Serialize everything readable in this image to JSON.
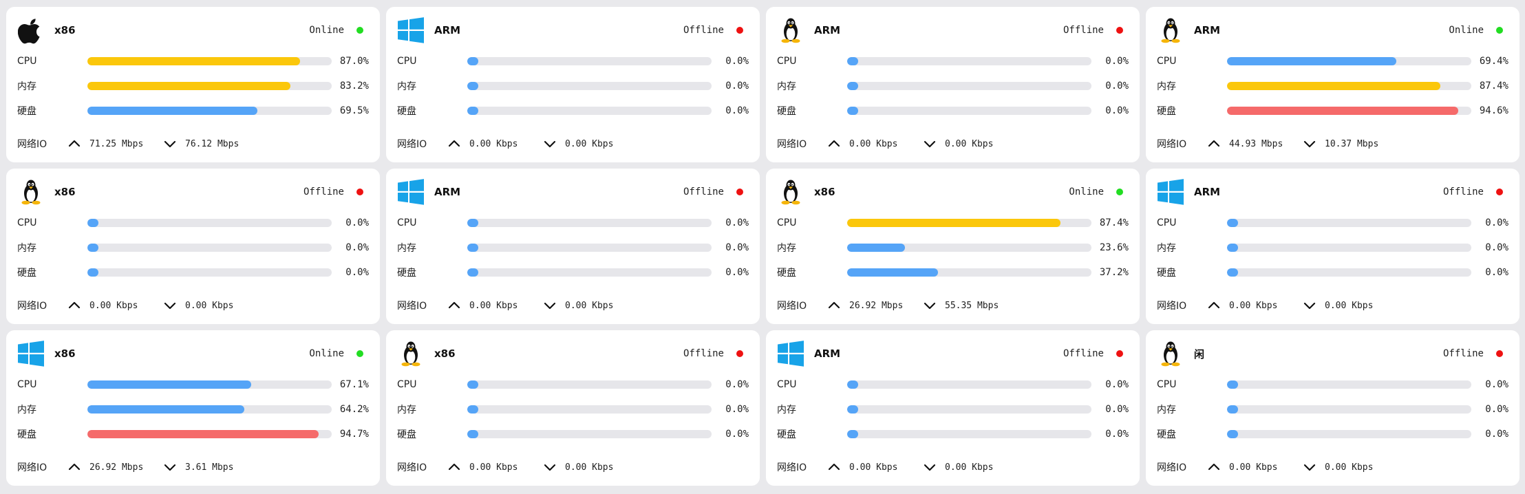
{
  "labels": {
    "cpu": "CPU",
    "mem": "内存",
    "disk": "硬盘",
    "net": "网络IO"
  },
  "colors": {
    "online": "#22dd22",
    "offline": "#ee1111",
    "yellow": "#fbc70b",
    "blue": "#55a4f7",
    "red": "#f56a6a",
    "track": "#e6e6ea",
    "windows": "#18a3e8"
  },
  "cards": [
    {
      "os_icon": "apple-icon",
      "arch": "x86",
      "status": "Online",
      "online": true,
      "cpu": {
        "value": 87.0,
        "text": "87.0%",
        "color": "yellow"
      },
      "mem": {
        "value": 83.2,
        "text": "83.2%",
        "color": "yellow"
      },
      "disk": {
        "value": 69.5,
        "text": "69.5%",
        "color": "blue"
      },
      "net_up": "71.25 Mbps",
      "net_down": "76.12 Mbps"
    },
    {
      "os_icon": "windows-icon",
      "arch": "ARM",
      "status": "Offline",
      "online": false,
      "cpu": {
        "value": 0.0,
        "text": "0.0%",
        "color": "blue"
      },
      "mem": {
        "value": 0.0,
        "text": "0.0%",
        "color": "blue"
      },
      "disk": {
        "value": 0.0,
        "text": "0.0%",
        "color": "blue"
      },
      "net_up": "0.00 Kbps",
      "net_down": "0.00 Kbps"
    },
    {
      "os_icon": "linux-icon",
      "arch": "ARM",
      "status": "Offline",
      "online": false,
      "cpu": {
        "value": 0.0,
        "text": "0.0%",
        "color": "blue"
      },
      "mem": {
        "value": 0.0,
        "text": "0.0%",
        "color": "blue"
      },
      "disk": {
        "value": 0.0,
        "text": "0.0%",
        "color": "blue"
      },
      "net_up": "0.00 Kbps",
      "net_down": "0.00 Kbps"
    },
    {
      "os_icon": "linux-icon",
      "arch": "ARM",
      "status": "Online",
      "online": true,
      "cpu": {
        "value": 69.4,
        "text": "69.4%",
        "color": "blue"
      },
      "mem": {
        "value": 87.4,
        "text": "87.4%",
        "color": "yellow"
      },
      "disk": {
        "value": 94.6,
        "text": "94.6%",
        "color": "red"
      },
      "net_up": "44.93 Mbps",
      "net_down": "10.37 Mbps"
    },
    {
      "os_icon": "linux-icon",
      "arch": "x86",
      "status": "Offline",
      "online": false,
      "cpu": {
        "value": 0.0,
        "text": "0.0%",
        "color": "blue"
      },
      "mem": {
        "value": 0.0,
        "text": "0.0%",
        "color": "blue"
      },
      "disk": {
        "value": 0.0,
        "text": "0.0%",
        "color": "blue"
      },
      "net_up": "0.00 Kbps",
      "net_down": "0.00 Kbps"
    },
    {
      "os_icon": "windows-icon",
      "arch": "ARM",
      "status": "Offline",
      "online": false,
      "cpu": {
        "value": 0.0,
        "text": "0.0%",
        "color": "blue"
      },
      "mem": {
        "value": 0.0,
        "text": "0.0%",
        "color": "blue"
      },
      "disk": {
        "value": 0.0,
        "text": "0.0%",
        "color": "blue"
      },
      "net_up": "0.00 Kbps",
      "net_down": "0.00 Kbps"
    },
    {
      "os_icon": "linux-icon",
      "arch": "x86",
      "status": "Online",
      "online": true,
      "cpu": {
        "value": 87.4,
        "text": "87.4%",
        "color": "yellow"
      },
      "mem": {
        "value": 23.6,
        "text": "23.6%",
        "color": "blue"
      },
      "disk": {
        "value": 37.2,
        "text": "37.2%",
        "color": "blue"
      },
      "net_up": "26.92 Mbps",
      "net_down": "55.35 Mbps"
    },
    {
      "os_icon": "windows-icon",
      "arch": "ARM",
      "status": "Offline",
      "online": false,
      "cpu": {
        "value": 0.0,
        "text": "0.0%",
        "color": "blue"
      },
      "mem": {
        "value": 0.0,
        "text": "0.0%",
        "color": "blue"
      },
      "disk": {
        "value": 0.0,
        "text": "0.0%",
        "color": "blue"
      },
      "net_up": "0.00 Kbps",
      "net_down": "0.00 Kbps"
    },
    {
      "os_icon": "windows-icon",
      "arch": "x86",
      "status": "Online",
      "online": true,
      "cpu": {
        "value": 67.1,
        "text": "67.1%",
        "color": "blue"
      },
      "mem": {
        "value": 64.2,
        "text": "64.2%",
        "color": "blue"
      },
      "disk": {
        "value": 94.7,
        "text": "94.7%",
        "color": "red"
      },
      "net_up": "26.92 Mbps",
      "net_down": "3.61 Mbps"
    },
    {
      "os_icon": "linux-icon",
      "arch": "x86",
      "status": "Offline",
      "online": false,
      "cpu": {
        "value": 0.0,
        "text": "0.0%",
        "color": "blue"
      },
      "mem": {
        "value": 0.0,
        "text": "0.0%",
        "color": "blue"
      },
      "disk": {
        "value": 0.0,
        "text": "0.0%",
        "color": "blue"
      },
      "net_up": "0.00 Kbps",
      "net_down": "0.00 Kbps"
    },
    {
      "os_icon": "windows-icon",
      "arch": "ARM",
      "status": "Offline",
      "online": false,
      "cpu": {
        "value": 0.0,
        "text": "0.0%",
        "color": "blue"
      },
      "mem": {
        "value": 0.0,
        "text": "0.0%",
        "color": "blue"
      },
      "disk": {
        "value": 0.0,
        "text": "0.0%",
        "color": "blue"
      },
      "net_up": "0.00 Kbps",
      "net_down": "0.00 Kbps"
    },
    {
      "os_icon": "linux-icon",
      "arch": "闲",
      "status": "Offline",
      "online": false,
      "cpu": {
        "value": 0.0,
        "text": "0.0%",
        "color": "blue"
      },
      "mem": {
        "value": 0.0,
        "text": "0.0%",
        "color": "blue"
      },
      "disk": {
        "value": 0.0,
        "text": "0.0%",
        "color": "blue"
      },
      "net_up": "0.00 Kbps",
      "net_down": "0.00 Kbps"
    }
  ]
}
